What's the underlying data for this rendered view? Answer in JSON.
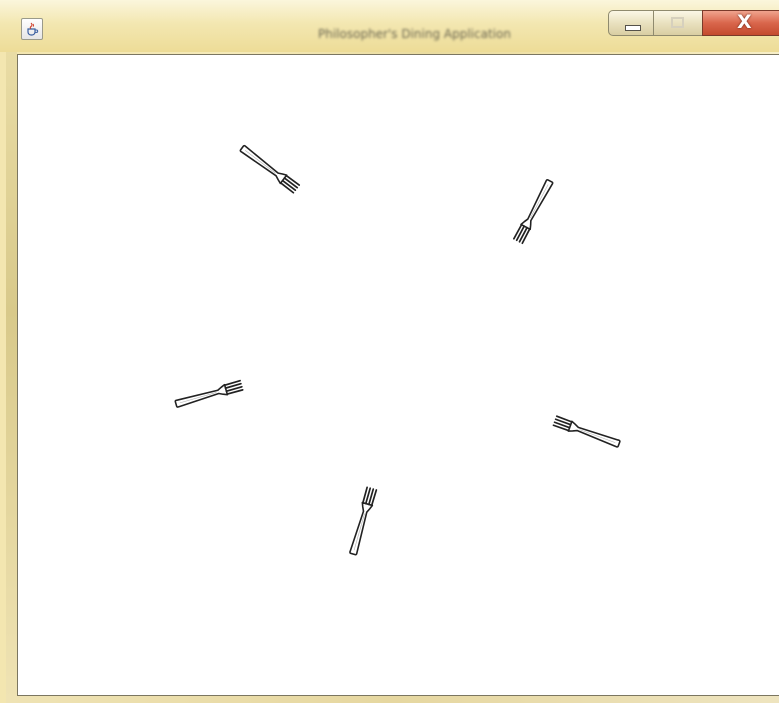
{
  "window": {
    "title": "Philosopher's Dining Application",
    "app_icon": "java-cup-icon",
    "controls": {
      "minimize_icon": "minimize-icon",
      "maximize_icon": "maximize-icon",
      "close_icon": "close-icon",
      "close_label": "X"
    }
  },
  "canvas": {
    "background": "#ffffff",
    "fork_icon": "fork-icon",
    "fork_color": "#222222",
    "fork_count": 5
  }
}
